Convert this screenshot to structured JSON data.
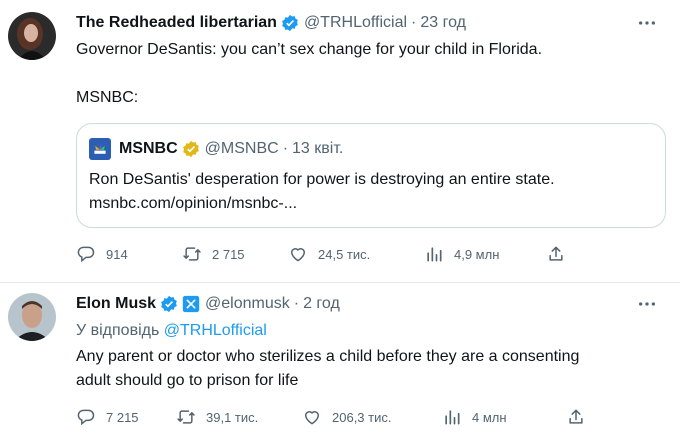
{
  "tweets": [
    {
      "author_name": "The Redheaded libertarian",
      "handle": "@TRHLofficial",
      "separator": "·",
      "time": "23 год",
      "text_line1": "Governor DeSantis: you can’t sex change for your child in Florida.",
      "text_line2": "MSNBC:",
      "quote": {
        "author_name": "MSNBC",
        "handle": "@MSNBC",
        "separator": "·",
        "time": "13 квіт.",
        "text_line1": "Ron DeSantis' desperation for power is destroying an entire state.",
        "text_line2": "msnbc.com/opinion/msnbc-..."
      },
      "stats": {
        "replies": "914",
        "retweets": "2 715",
        "likes": "24,5 тис.",
        "views": "4,9 млн"
      }
    },
    {
      "author_name": "Elon Musk",
      "handle": "@elonmusk",
      "separator": "·",
      "time": "2 год",
      "reply_prefix": "У відповідь",
      "reply_mention": "@TRHLofficial",
      "text_line1": "Any parent or doctor who sterilizes a child before they are a consenting",
      "text_line2": "adult should go to prison for life",
      "stats": {
        "replies": "7 215",
        "retweets": "39,1 тис.",
        "likes": "206,3 тис.",
        "views": "4 млн"
      }
    }
  ],
  "colors": {
    "verified_blue": "#1d9bf0",
    "verified_gold": "#e2b719",
    "muted_text": "#536471",
    "mention_blue": "#1d9bf0"
  },
  "icons": [
    "more-icon",
    "verified-icon",
    "reply-icon",
    "retweet-icon",
    "like-icon",
    "views-icon",
    "share-icon",
    "government-badge-icon",
    "msnbc-logo-icon"
  ]
}
